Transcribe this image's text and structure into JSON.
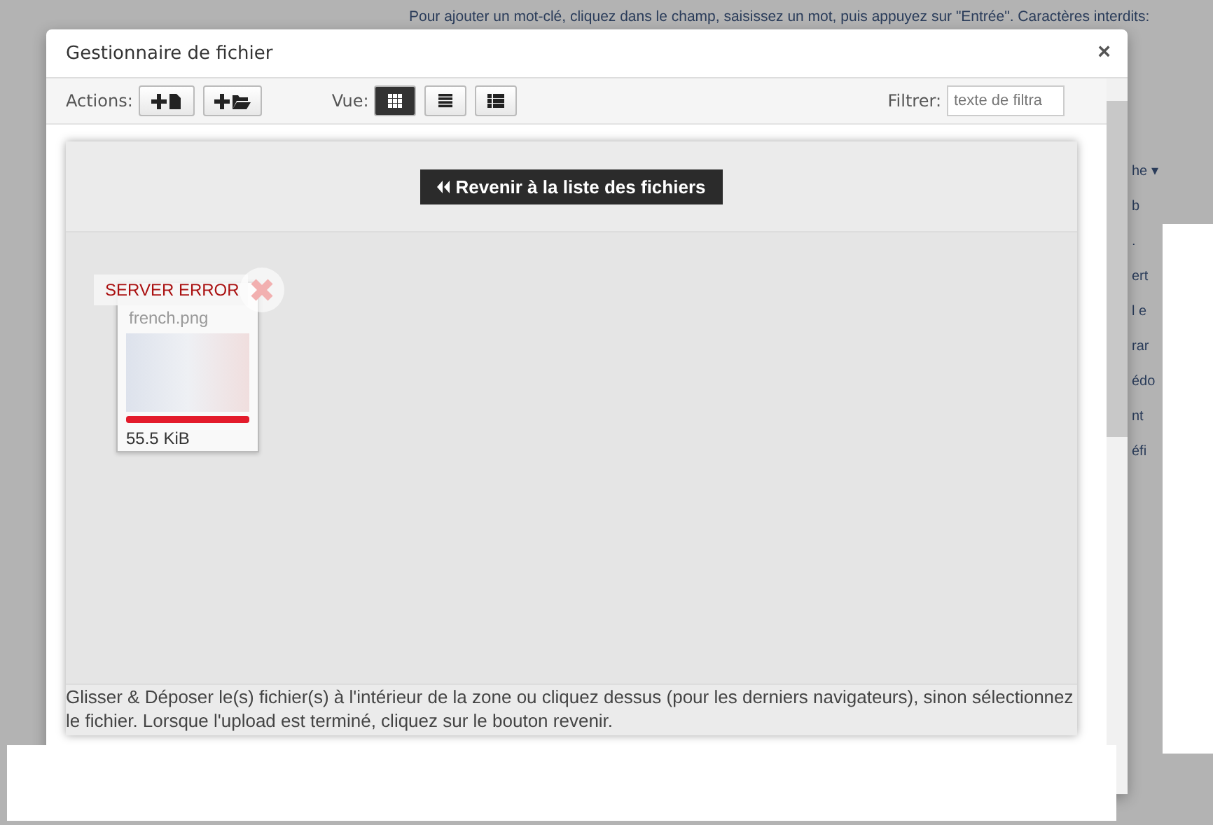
{
  "page": {
    "hint": "Pour ajouter un mot-clé, cliquez dans le champ, saisissez un mot, puis appuyez sur \"Entrée\". Caractères interdits:",
    "fragments": [
      "he ▾",
      "b",
      ".",
      "ert",
      "l e",
      "rar",
      "édo",
      "nt",
      "éfi"
    ]
  },
  "modal": {
    "title": "Gestionnaire de fichier",
    "close": "×",
    "toolbar": {
      "actions_label": "Actions:",
      "view_label": "Vue:",
      "views": [
        {
          "kind": "grid",
          "selected": true
        },
        {
          "kind": "list",
          "selected": false
        },
        {
          "kind": "table",
          "selected": false
        }
      ],
      "filter_label": "Filtrer:",
      "filter_placeholder": "texte de filtra"
    },
    "back_button": "Revenir à la liste des fichiers",
    "files": [
      {
        "name": "french.png",
        "size": "55.5 KiB",
        "error": "SERVER ERROR",
        "level": 1
      }
    ],
    "help": "Glisser & Déposer le(s) fichier(s) à l'intérieur de la zone ou cliquez dessus (pour les derniers navigateurs), sinon sélectionnez le fichier. Lorsque l'upload est terminé, cliquez sur le bouton revenir."
  }
}
